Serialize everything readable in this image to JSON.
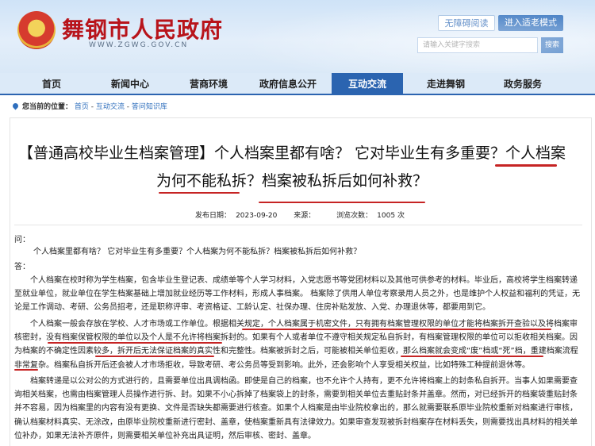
{
  "header": {
    "site_title": "舞钢市人民政府",
    "site_subtitle": "WWW.ZGWG.GOV.CN",
    "accessibility_label": "无障碍阅读",
    "elder_mode_label": "进入适老模式",
    "search": {
      "placeholder": "请输入关键字搜索",
      "button_label": "搜索"
    }
  },
  "nav": {
    "items": [
      "首页",
      "新闻中心",
      "营商环境",
      "政府信息公开",
      "互动交流",
      "走进舞钢",
      "政务服务"
    ],
    "active_index": 4
  },
  "breadcrumb": {
    "prefix": "您当前的位置：",
    "items": [
      "首页",
      "互动交流",
      "答问知识库"
    ],
    "separator": " - "
  },
  "article": {
    "title_line1": "【普通高校毕业生档案管理】个人档案里都有啥？ 它对毕业生有多重要？个人档案",
    "title_line2": "为何不能私拆？档案被私拆后如何补救？",
    "meta": {
      "publish_label": "发布日期：",
      "publish_date": "2023-09-20",
      "source_label": "来源：",
      "source": "",
      "views_label": "浏览次数：",
      "views": "1005",
      "views_unit": "次"
    },
    "question_label": "问：",
    "question": "个人档案里都有啥？ 它对毕业生有多重要？个人档案为何不能私拆？档案被私拆后如何补救？",
    "answer_label": "答：",
    "paragraphs": [
      "个人档案在校时称为学生档案，包含毕业生登记表、成绩单等个人学习材料，入党志愿书等党团材料以及其他可供参考的材料。毕业后，高校将学生档案转递至就业单位，就业单位在学生档案基础上增加就业经历等工作材料，形成人事档案。 档案除了供用人单位考察录用人员之外，也是维护个人权益和福利的凭证，无论是工作调动、考研、公务员招考，还是职称评审、考资格证、工龄认定、社保办理、住房补贴发放、入党、办理退休等，都要用到它。",
      "个人档案一般会存放在学校、人才市场或工作单位。根据相关规定，个人档案属于机密文件，只有拥有档案管理权限的单位才能将档案拆开查验以及将档案审核密封，没有档案保管权限的单位以及个人是不允许将档案拆封的。如果有个人或者单位不遵守相关规定私自拆封，有档案管理权限的单位可以拒收相关档案。因为档案的不确定性因素较多，拆开后无法保证档案的真实性和完整性。档案被拆封之后，可能被相关单位拒收，那么档案就会变成“废”档或“死”档，重建档案流程非常复杂。档案私自拆开后还会被人才市场拒收，导致考研、考公务员等受到影响。此外，还会影响个人享受相关权益，比如特殊工种提前退休等。",
      "档案转递是以公对公的方式进行的，且需要单位出具调档函。即使是自己的档案，也不允许个人持有，更不允许将档案上的封条私自拆开。当事人如果需要查询相关档案，也需由档案管理人员操作进行拆、封。如果不小心拆掉了档案袋上的封条，需要到相关单位去重贴封条并盖章。然而，对已经拆开的档案袋重贴封条并不容易，因为档案里的内容有没有更换、文件是否缺失都需要进行核查。如果个人档案是由毕业院校拿出的，那么就需要联系原毕业院校重新对档案进行审核，确认档案材料真实、无涂改，由原毕业院校重新进行密封、盖章，使档案重新具有法律效力。如果审查发现被拆封档案存在材料丢失，则需要找出具材料的相关单位补办，如果无法补齐原件，则需要相关单位补充出具证明，然后审核、密封、盖章。"
    ]
  }
}
